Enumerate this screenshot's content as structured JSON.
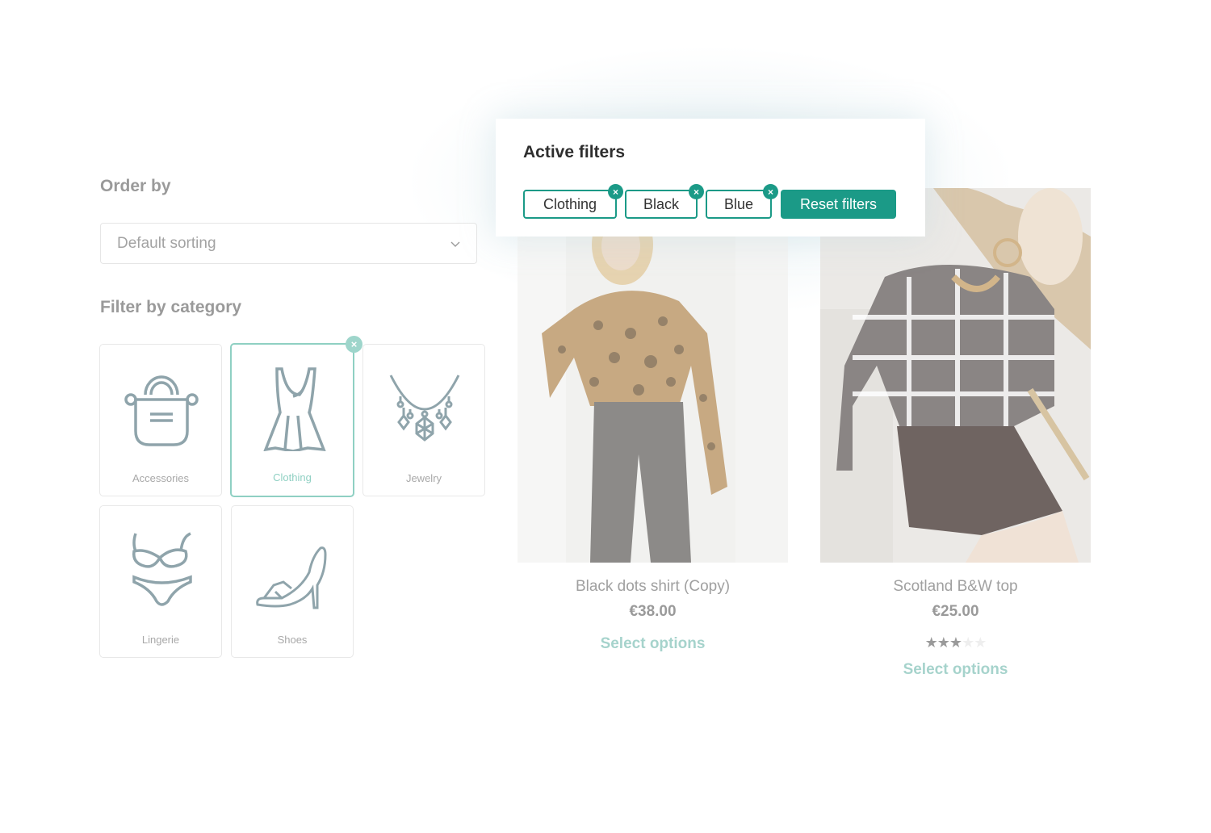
{
  "order_by": {
    "title": "Order by",
    "select_value": "Default sorting"
  },
  "filter_by_category": {
    "title": "Filter by category",
    "categories": [
      {
        "label": "Accessories",
        "icon": "handbag-icon",
        "active": false
      },
      {
        "label": "Clothing",
        "icon": "dress-icon",
        "active": true,
        "remove_glyph": "×"
      },
      {
        "label": "Jewelry",
        "icon": "necklace-icon",
        "active": false
      },
      {
        "label": "Lingerie",
        "icon": "lingerie-icon",
        "active": false
      },
      {
        "label": "Shoes",
        "icon": "high-heel-icon",
        "active": false
      }
    ]
  },
  "active_filters": {
    "title": "Active filters",
    "chips": [
      {
        "label": "Clothing",
        "remove_glyph": "×"
      },
      {
        "label": "Black",
        "remove_glyph": "×"
      },
      {
        "label": "Blue",
        "remove_glyph": "×"
      }
    ],
    "reset_label": "Reset filters"
  },
  "products": [
    {
      "name": "Black dots shirt (Copy)",
      "price": "€38.00",
      "action": "Select options",
      "rating": null,
      "image": "woman-lace-top-photo"
    },
    {
      "name": "Scotland B&W top",
      "price": "€25.00",
      "action": "Select options",
      "rating": {
        "value": 3,
        "max": 5
      },
      "image": "woman-plaid-top-photo"
    }
  ],
  "colors": {
    "accent": "#1b9a87",
    "accent_faded": "#8fd0c3",
    "icon_stroke": "#8fa4ab"
  }
}
